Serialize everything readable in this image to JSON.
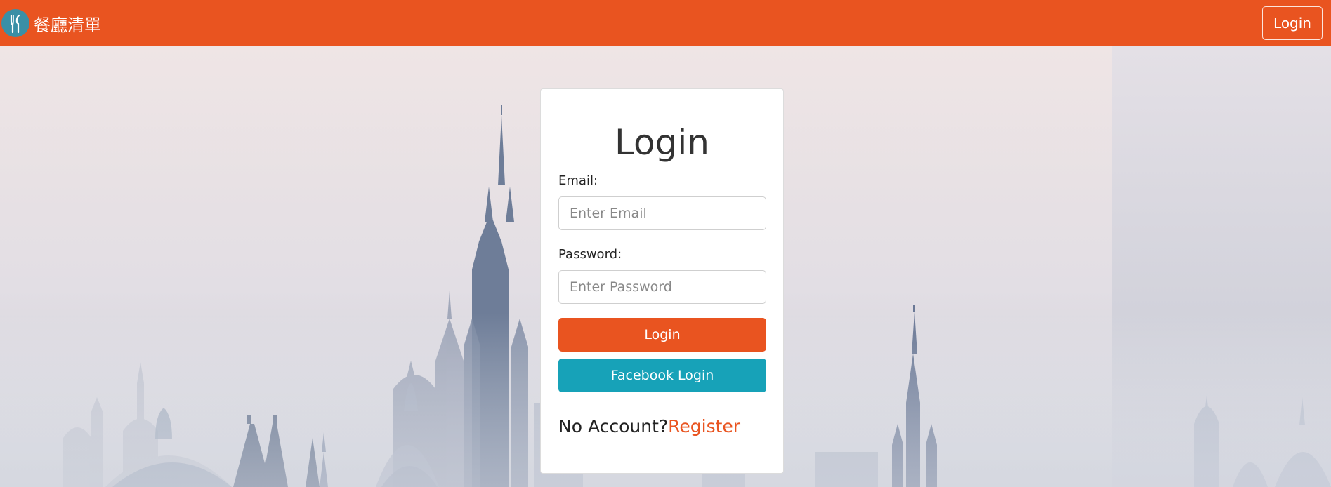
{
  "navbar": {
    "brand_text": "餐廳清單",
    "login_label": "Login"
  },
  "login_card": {
    "title": "Login",
    "email": {
      "label": "Email:",
      "placeholder": "Enter Email",
      "value": ""
    },
    "password": {
      "label": "Password:",
      "placeholder": "Enter Password",
      "value": ""
    },
    "login_button": "Login",
    "facebook_button": "Facebook Login",
    "no_account_text": "No Account?",
    "register_link": "Register"
  },
  "icons": {
    "brand": "utensils-icon"
  },
  "colors": {
    "primary": "#e95420",
    "facebook": "#17a2b8",
    "brand_logo_bg": "#3a8fa6"
  }
}
